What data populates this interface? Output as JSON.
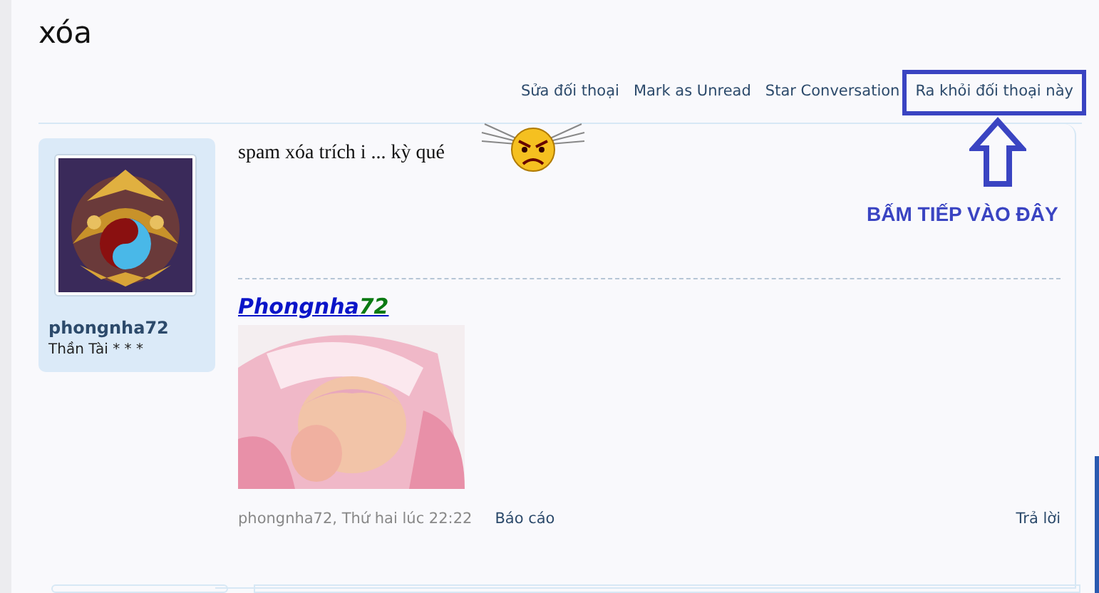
{
  "title": "xóa",
  "actions": [
    {
      "label": "Sửa đối thoại",
      "highlighted": false
    },
    {
      "label": "Mark as Unread",
      "highlighted": false
    },
    {
      "label": "Star Conversation",
      "highlighted": false
    },
    {
      "label": "Ra khỏi đối thoại này",
      "highlighted": true
    }
  ],
  "annotation": {
    "text": "BẤM TIẾP VÀO ĐÂY"
  },
  "message": {
    "author": "phongnha72",
    "user_title": "Thần Tài * * *",
    "text": "spam xóa trích i ... kỳ qué",
    "signature": {
      "name": "Phongnha",
      "number": "72"
    },
    "meta": "phongnha72, Thứ hai lúc 22:22",
    "report": "Báo cáo",
    "reply": "Trả lời"
  }
}
